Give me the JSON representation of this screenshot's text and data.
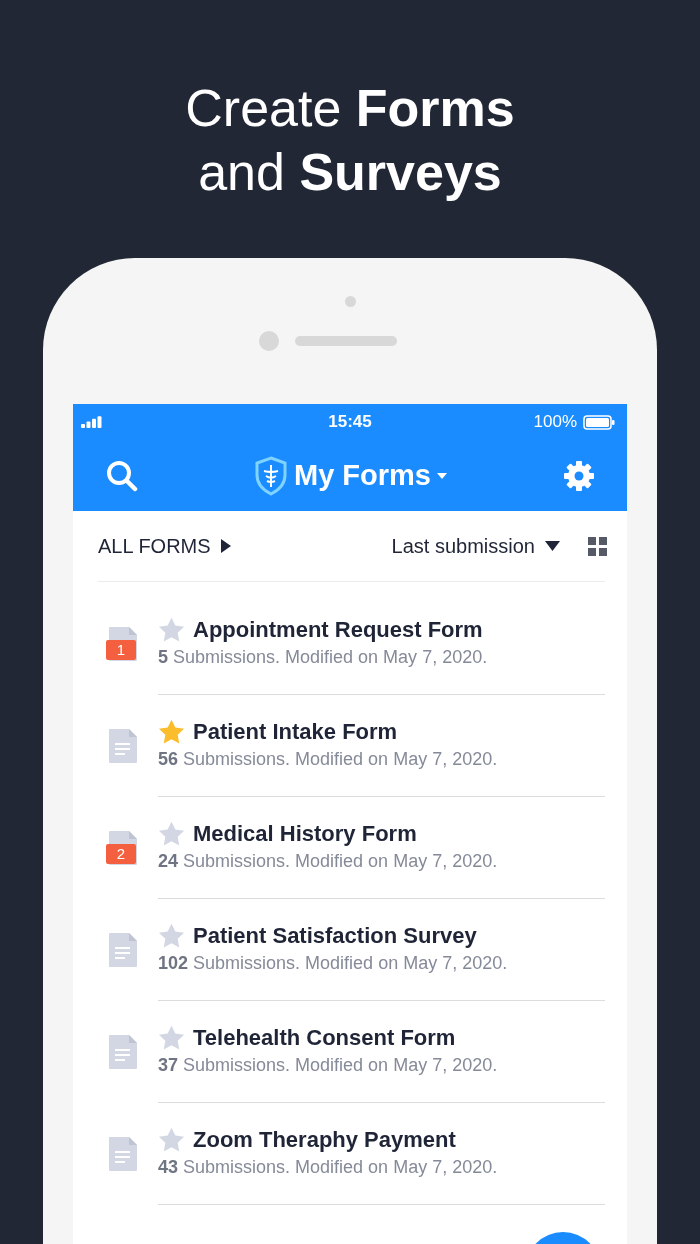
{
  "headline": [
    "Create **Forms**",
    "and **Surveys**"
  ],
  "status_bar": {
    "time": "15:45",
    "battery": "100%"
  },
  "header": {
    "title": "My Forms"
  },
  "filter": {
    "folder": "ALL FORMS",
    "sort": "Last submission"
  },
  "forms": [
    {
      "title": "Appointment Request Form",
      "subtitle": "**5** Submissions. Modified on May 7, 2020.",
      "starred": false,
      "badge": "1"
    },
    {
      "title": "Patient Intake Form",
      "subtitle": "**56** Submissions. Modified on May 7, 2020.",
      "starred": true
    },
    {
      "title": "Medical History Form",
      "subtitle": "**24** Submissions. Modified on May 7, 2020.",
      "starred": false,
      "badge": "2"
    },
    {
      "title": "Patient Satisfaction Survey",
      "subtitle": "**102** Submissions. Modified on May 7, 2020.",
      "starred": false
    },
    {
      "title": "Telehealth Consent Form",
      "subtitle": "**37** Submissions. Modified on May 7, 2020.",
      "starred": false
    },
    {
      "title": "Zoom Theraphy Payment",
      "subtitle": "**43** Submissions. Modified on May 7, 2020.",
      "starred": false
    }
  ]
}
